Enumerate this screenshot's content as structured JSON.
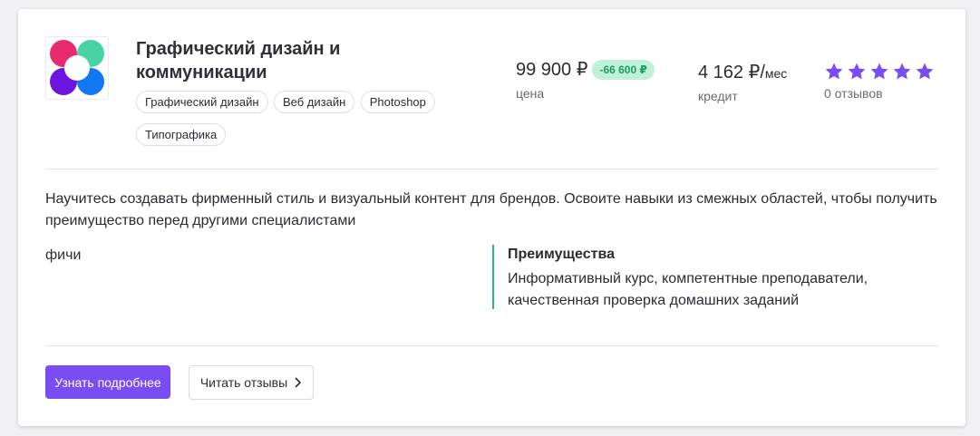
{
  "course": {
    "title": "Графический дизайн и коммуникации",
    "tags": [
      "Графический дизайн",
      "Веб дизайн",
      "Photoshop",
      "Типографика"
    ],
    "logo_colors": [
      "#ea2a6e",
      "#49d3a2",
      "#6a16e0",
      "#1178f2"
    ]
  },
  "price": {
    "value": "99 900 ₽",
    "discount": "-66 600 ₽",
    "label": "цена"
  },
  "credit": {
    "value": "4 162 ₽/",
    "unit": "мес",
    "label": "кредит"
  },
  "rating": {
    "stars": 5,
    "star_color": "#7a4df4",
    "reviews_label": "0 отзывов"
  },
  "description": "Научитесь создавать фирменный стиль и визуальный контент для брендов. Освоите навыки из смежных областей, чтобы получить преимущество перед другими специалистами",
  "features_label": "фичи",
  "advantages": {
    "title": "Преимущества",
    "text": "Информативный курс, компетентные преподаватели, качественная проверка домашних заданий"
  },
  "actions": {
    "primary_label": "Узнать подробнее",
    "secondary_label": "Читать отзывы",
    "secondary_icon": "chevron-right-icon"
  },
  "colors": {
    "accent": "#7a4df4",
    "advantage_border": "#2fb87a",
    "discount_bg": "#bff0d8",
    "discount_text": "#1b9e63"
  }
}
